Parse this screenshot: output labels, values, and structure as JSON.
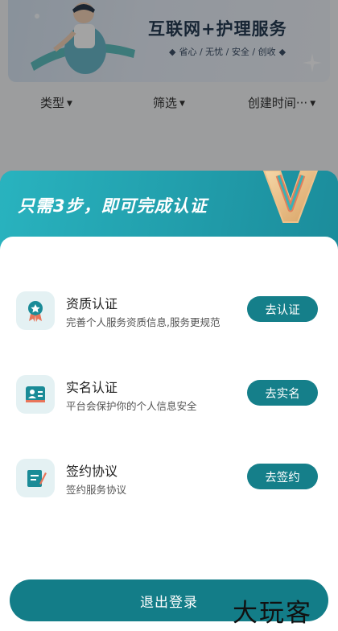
{
  "banner": {
    "title": "互联网+护理服务",
    "tags": [
      "省心",
      "无忧",
      "安全",
      "创收"
    ]
  },
  "filters": [
    {
      "label": "类型"
    },
    {
      "label": "筛选"
    },
    {
      "label": "创建时间···"
    }
  ],
  "modal": {
    "title": "只需3步，即可完成认证",
    "steps": [
      {
        "title": "资质认证",
        "desc": "完善个人服务资质信息,服务更规范",
        "button": "去认证",
        "icon": "award-ribbon-icon"
      },
      {
        "title": "实名认证",
        "desc": "平台会保护你的个人信息安全",
        "button": "去实名",
        "icon": "id-card-icon"
      },
      {
        "title": "签约协议",
        "desc": "签约服务协议",
        "button": "去签约",
        "icon": "contract-pen-icon"
      }
    ],
    "logout_label": "退出登录"
  },
  "watermark": "大玩客",
  "colors": {
    "primary": "#157f8a",
    "header_gradient_start": "#29b3bf",
    "header_gradient_end": "#1b8c9b",
    "icon_bg": "#e4f1f3"
  }
}
